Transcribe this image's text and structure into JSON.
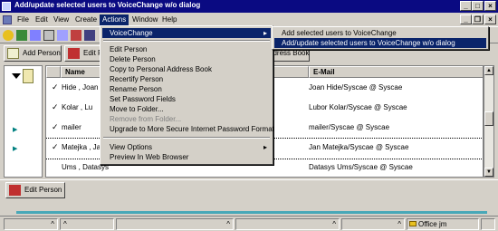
{
  "window": {
    "title": "Add/update selected users to VoiceChange w/o dialog",
    "min": "_",
    "max": "□",
    "close": "×",
    "inner_min": "_",
    "inner_restore": "❐",
    "inner_close": "×"
  },
  "menubar": {
    "items": [
      "File",
      "Edit",
      "View",
      "Create",
      "Actions",
      "Window",
      "Help"
    ]
  },
  "actionbar": {
    "add_person": "Add Person",
    "edit_person": "Edit P",
    "address_book": "ddress Book"
  },
  "list": {
    "columns": {
      "name": "Name",
      "email": "E-Mail"
    },
    "rows": [
      {
        "check": "✓",
        "name": "Hide , Joan",
        "email": "Joan Hide/Syscae @ Syscae"
      },
      {
        "check": "✓",
        "name": "Kolar , Lu",
        "email": "Lubor Kolar/Syscae @ Syscae"
      },
      {
        "check": "✓",
        "name": "mailer",
        "email": "mailer/Syscae @ Syscae"
      },
      {
        "check": "✓",
        "name": "Matejka , Jar",
        "email": "Jan Matejka/Syscae @ Syscae"
      },
      {
        "check": "",
        "name": "Ums , Datasys",
        "email": "Datasys Ums/Syscae @ Syscae"
      }
    ]
  },
  "actions_menu": {
    "items": [
      {
        "label": "VoiceChange",
        "arrow": "▸"
      },
      {
        "label": "Edit Person"
      },
      {
        "label": "Delete Person"
      },
      {
        "label": "Copy to Personal Address Book"
      },
      {
        "label": "Recertify Person"
      },
      {
        "label": "Rename Person"
      },
      {
        "label": "Set Password Fields"
      },
      {
        "label": "Move to Folder..."
      },
      {
        "label": "Remove from Folder..."
      },
      {
        "label": "Upgrade to More Secure Internet Password Format"
      },
      {
        "label": "View Options",
        "arrow": "▸"
      },
      {
        "label": "Preview In Web Browser"
      }
    ]
  },
  "voicechange_submenu": {
    "items": [
      "Add selected users to VoiceChange",
      "Add/update selected users to VoiceChange w/o dialog"
    ]
  },
  "bottombar": {
    "edit_person": "Edit Person"
  },
  "statusbar": {
    "location": "Office jm",
    "arrows": "^"
  },
  "colors": {
    "titlebar": "#0a0a82",
    "highlight": "#0a246a",
    "face": "#d4d0c8"
  }
}
